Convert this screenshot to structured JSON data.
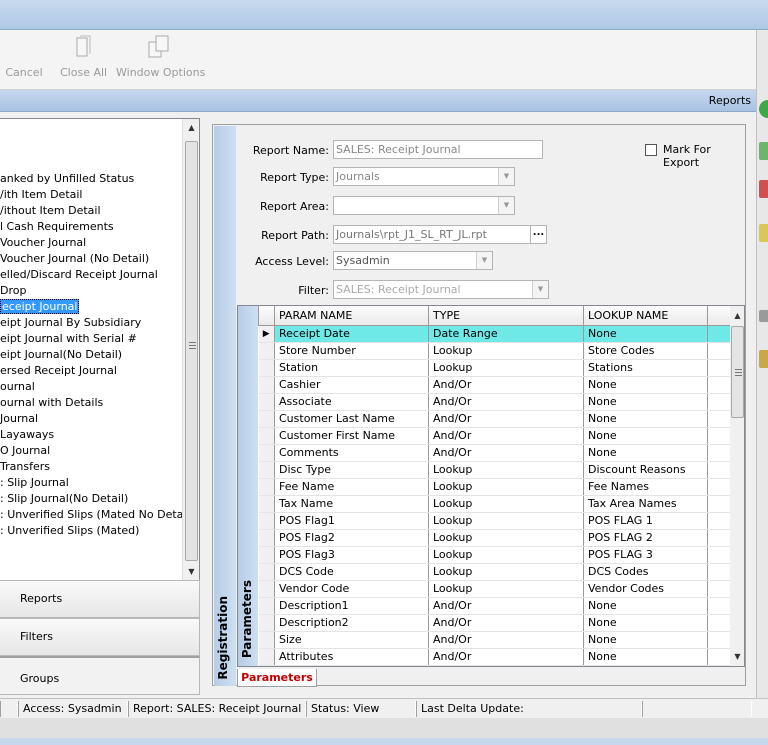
{
  "toolbar": {
    "buttons": [
      {
        "label": "Cancel"
      },
      {
        "label": "Close All"
      },
      {
        "label": "Window Options"
      }
    ]
  },
  "band": {
    "title": "Reports"
  },
  "tree": {
    "items": [
      "anked by Unfilled Status",
      "/ith Item Detail",
      "/ithout Item Detail",
      "l Cash Requirements",
      "Voucher Journal",
      "Voucher Journal (No Detail)",
      "elled/Discard Receipt Journal",
      "Drop",
      "eceipt Journal",
      "eipt Journal By Subsidiary",
      "eipt Journal with Serial #",
      "eipt Journal(No Detail)",
      "ersed Receipt Journal",
      "ournal",
      "ournal with Details",
      "Journal",
      "Layaways",
      "O Journal",
      "Transfers",
      ": Slip Journal",
      ": Slip Journal(No Detail)",
      ": Unverified Slips (Mated No Detail)",
      ": Unverified Slips (Mated)"
    ],
    "selected_index": 8
  },
  "nav": {
    "reports": "Reports",
    "filters": "Filters",
    "groups": "Groups"
  },
  "form": {
    "registration_label": "Registration",
    "report_name_label": "Report Name:",
    "report_name_value": "SALES: Receipt Journal",
    "mark_export_label": "Mark For Export",
    "report_type_label": "Report Type:",
    "report_type_value": "Journals",
    "report_area_label": "Report Area:",
    "report_area_value": "",
    "report_path_label": "Report Path:",
    "report_path_value": "Journals\\rpt_J1_SL_RT_JL.rpt",
    "report_path_btn": "...",
    "access_level_label": "Access Level:",
    "access_level_value": "Sysadmin",
    "filter_label": "Filter:",
    "filter_value": "SALES: Receipt Journal"
  },
  "grid": {
    "side_label": "Parameters",
    "columns": [
      "PARAM NAME",
      "TYPE",
      "LOOKUP NAME"
    ],
    "rows": [
      [
        "Receipt Date",
        "Date Range",
        "None"
      ],
      [
        "Store Number",
        "Lookup",
        "Store Codes"
      ],
      [
        "Station",
        "Lookup",
        "Stations"
      ],
      [
        "Cashier",
        "And/Or",
        "None"
      ],
      [
        "Associate",
        "And/Or",
        "None"
      ],
      [
        "Customer Last Name",
        "And/Or",
        "None"
      ],
      [
        "Customer First Name",
        "And/Or",
        "None"
      ],
      [
        "Comments",
        "And/Or",
        "None"
      ],
      [
        "Disc Type",
        "Lookup",
        "Discount Reasons"
      ],
      [
        "Fee Name",
        "Lookup",
        "Fee Names"
      ],
      [
        "Tax Name",
        "Lookup",
        "Tax Area Names"
      ],
      [
        "POS Flag1",
        "Lookup",
        "POS FLAG 1"
      ],
      [
        "POS Flag2",
        "Lookup",
        "POS FLAG 2"
      ],
      [
        "POS Flag3",
        "Lookup",
        "POS FLAG 3"
      ],
      [
        "DCS Code",
        "Lookup",
        "DCS Codes"
      ],
      [
        "Vendor Code",
        "Lookup",
        "Vendor Codes"
      ],
      [
        "Description1",
        "And/Or",
        "None"
      ],
      [
        "Description2",
        "And/Or",
        "None"
      ],
      [
        "Size",
        "And/Or",
        "None"
      ],
      [
        "Attributes",
        "And/Or",
        "None"
      ]
    ],
    "selected_row": 0
  },
  "tabs": {
    "parameters": "Parameters"
  },
  "status": {
    "access": "Access: Sysadmin",
    "report": "Report: SALES: Receipt Journal",
    "status": "Status: View",
    "last_update": "Last Delta Update:"
  },
  "colors": {
    "selected_row": "#6fe8e8",
    "tree_selection": "#3399ff",
    "tab_accent": "#c00000"
  }
}
